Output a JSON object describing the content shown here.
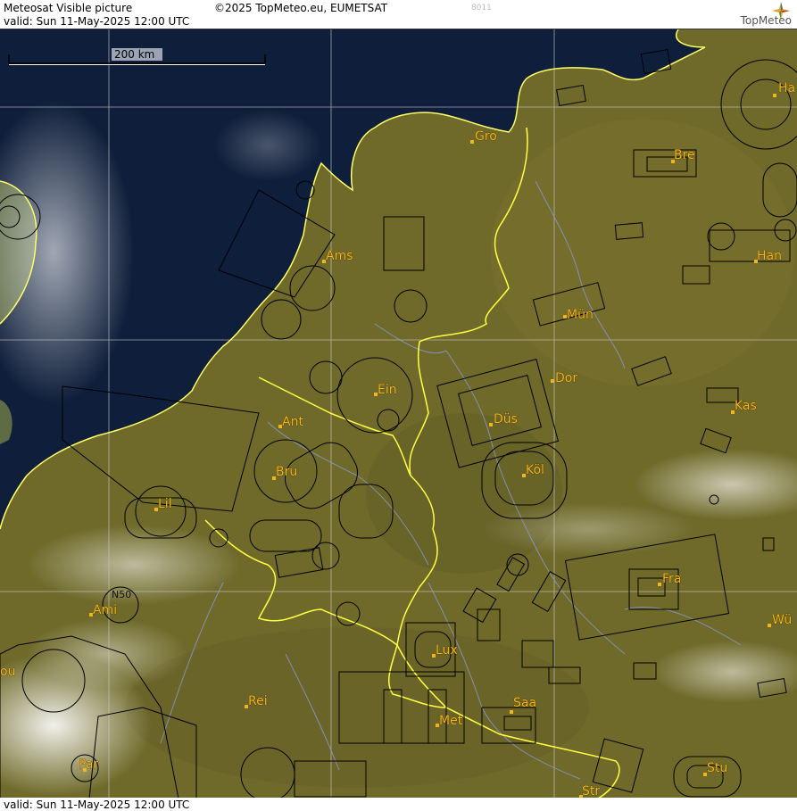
{
  "header": {
    "title": "Meteosat Visible picture",
    "copyright": "©2025 TopMeteo.eu, EUMETSAT",
    "code": "8011",
    "valid": "valid:  Sun  11-May-2025  12:00 UTC",
    "logo_text": "TopMeteo",
    "logo_icon": "compass-star-icon"
  },
  "footer": {
    "valid": "valid:  Sun  11-May-2025  12:00 UTC"
  },
  "map": {
    "scale_label": "200 km",
    "lat_label": "N50",
    "colors": {
      "sea": "#0f1e3a",
      "land": "#6f6a2a",
      "coastline": "#ffff66",
      "border": "#ffff44",
      "airspace": "#000000",
      "rivers": "#8a9ad6",
      "grid": "#c8c8c8",
      "city": "#f2b51c"
    },
    "cities": [
      "Gro",
      "Ams",
      "Bre",
      "Han",
      "Ha",
      "Mün",
      "Ein",
      "Dor",
      "Ant",
      "Düs",
      "Kas",
      "Bru",
      "Köl",
      "Lil",
      "Fra",
      "Ami",
      "Wü",
      "Lux",
      "Rei",
      "Saa",
      "Met",
      "Par",
      "Stu",
      "Str",
      "ou"
    ]
  }
}
